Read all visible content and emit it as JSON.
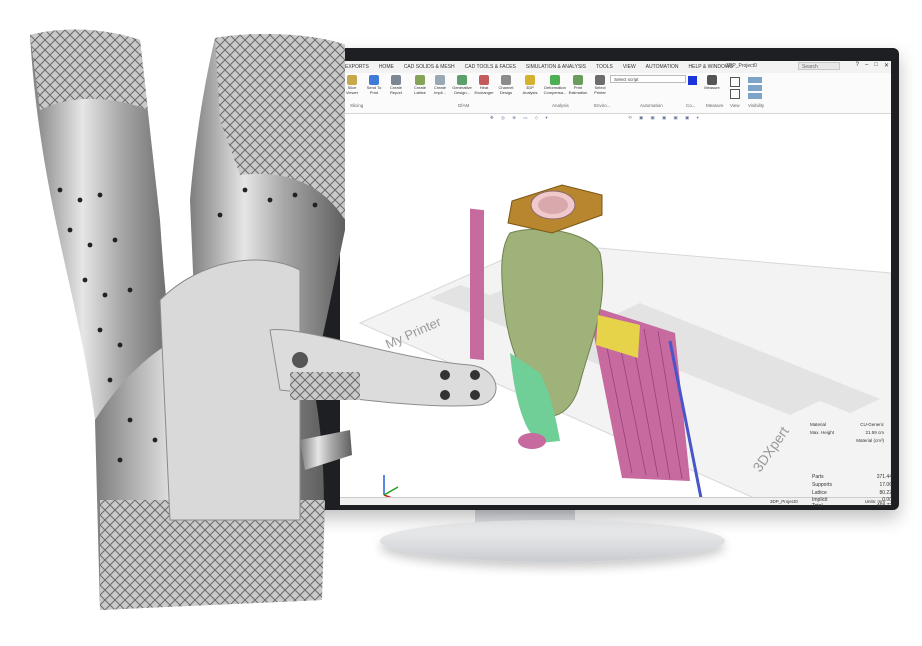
{
  "ribbon": {
    "tabs": [
      "EXPORTS",
      "HOME",
      "CAD SOLIDS & MESH",
      "CAD TOOLS & FACES",
      "SIMULATION & ANALYSIS",
      "TOOLS",
      "VIEW",
      "AUTOMATION",
      "HELP & WINDOWS"
    ],
    "window_title": "3DP_Project0",
    "search_placeholder": "Search",
    "buttons": [
      {
        "label": "Slice Viewer",
        "icon": "slice-viewer-icon"
      },
      {
        "label": "Send To Print",
        "icon": "send-to-print-icon"
      },
      {
        "label": "Create Report",
        "icon": "report-icon"
      },
      {
        "label": "Create Lattice",
        "icon": "lattice-icon"
      },
      {
        "label": "Create Impli...",
        "icon": "implicit-icon"
      },
      {
        "label": "Generative Design...",
        "icon": "generative-design-icon"
      },
      {
        "label": "Heat Exchanger",
        "icon": "heat-exchanger-icon"
      },
      {
        "label": "Channel Design",
        "icon": "channel-icon"
      },
      {
        "label": "3DP Analysis",
        "icon": "analysis-icon"
      },
      {
        "label": "Deformation Compensa...",
        "icon": "deformation-icon"
      },
      {
        "label": "Print Estimation",
        "icon": "print-estimation-icon"
      },
      {
        "label": "Select Printer",
        "icon": "printer-icon"
      },
      {
        "label": "Measure",
        "icon": "measure-icon"
      }
    ],
    "groups": [
      "Slicing",
      "DfAM",
      "Analysis",
      "Enviro...",
      "Automation",
      "Co...",
      "Measure",
      "View",
      "Visibility"
    ],
    "script_select": "Select script"
  },
  "scene": {
    "platform_label_1": "My Printer",
    "platform_label_2": "3DXpert"
  },
  "properties": {
    "material_label": "Material",
    "material_value": "CU-Generic",
    "max_height_label": "Max. Height",
    "max_height_value": "21.59",
    "max_height_unit": "cm",
    "material_volume_header": "Material (cm³)",
    "rows": [
      {
        "label": "Parts",
        "value": "371.44"
      },
      {
        "label": "Supports",
        "value": "17.06"
      },
      {
        "label": "Lattice",
        "value": "80.22"
      },
      {
        "label": "Implicit",
        "value": "0.00"
      },
      {
        "label": "Total",
        "value": "468.72"
      }
    ]
  },
  "status": {
    "project": "3DP_Project0",
    "units": "Units: mm"
  },
  "colors": {
    "monitor": "#1d1f22",
    "support_pink": "#c66aa0",
    "lattice_green": "#9fb27a",
    "part_gold": "#b8862e",
    "accent_blue": "#1a73e8"
  }
}
